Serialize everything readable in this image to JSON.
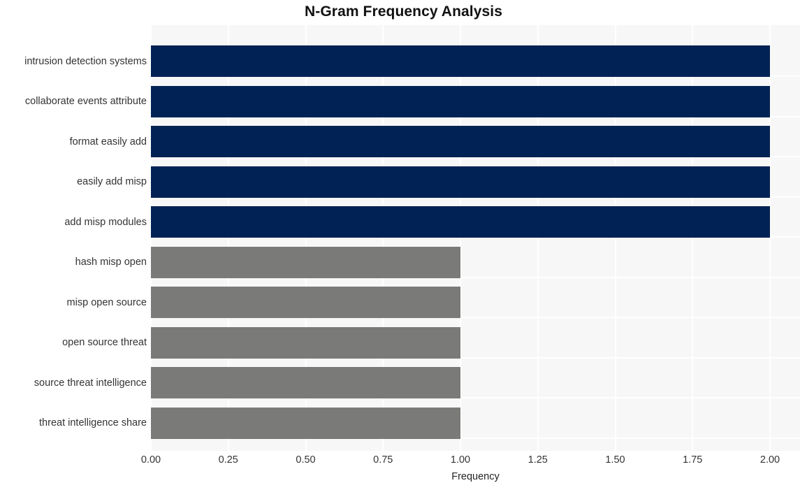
{
  "chart_data": {
    "type": "bar",
    "orientation": "horizontal",
    "title": "N-Gram Frequency Analysis",
    "xlabel": "Frequency",
    "ylabel": "",
    "xlim": [
      0.0,
      2.0
    ],
    "xticks": [
      "0.00",
      "0.25",
      "0.50",
      "0.75",
      "1.00",
      "1.25",
      "1.50",
      "1.75",
      "2.00"
    ],
    "xtick_values": [
      0.0,
      0.25,
      0.5,
      0.75,
      1.0,
      1.25,
      1.5,
      1.75,
      2.0
    ],
    "grid": true,
    "grid_color": "#ffffff",
    "plot_background": "#f7f7f7",
    "figure_background": "#ffffff",
    "legend": null,
    "categories": [
      "intrusion detection systems",
      "collaborate events attribute",
      "format easily add",
      "easily add misp",
      "add misp modules",
      "hash misp open",
      "misp open source",
      "open source threat",
      "source threat intelligence",
      "threat intelligence share"
    ],
    "values": [
      2,
      2,
      2,
      2,
      2,
      1,
      1,
      1,
      1,
      1
    ],
    "bar_colors": [
      "#002254",
      "#002254",
      "#002254",
      "#002254",
      "#002254",
      "#7a7a78",
      "#7a7a78",
      "#7a7a78",
      "#7a7a78",
      "#7a7a78"
    ],
    "colors": {
      "high_frequency": "#002254",
      "low_frequency": "#7a7a78"
    }
  }
}
